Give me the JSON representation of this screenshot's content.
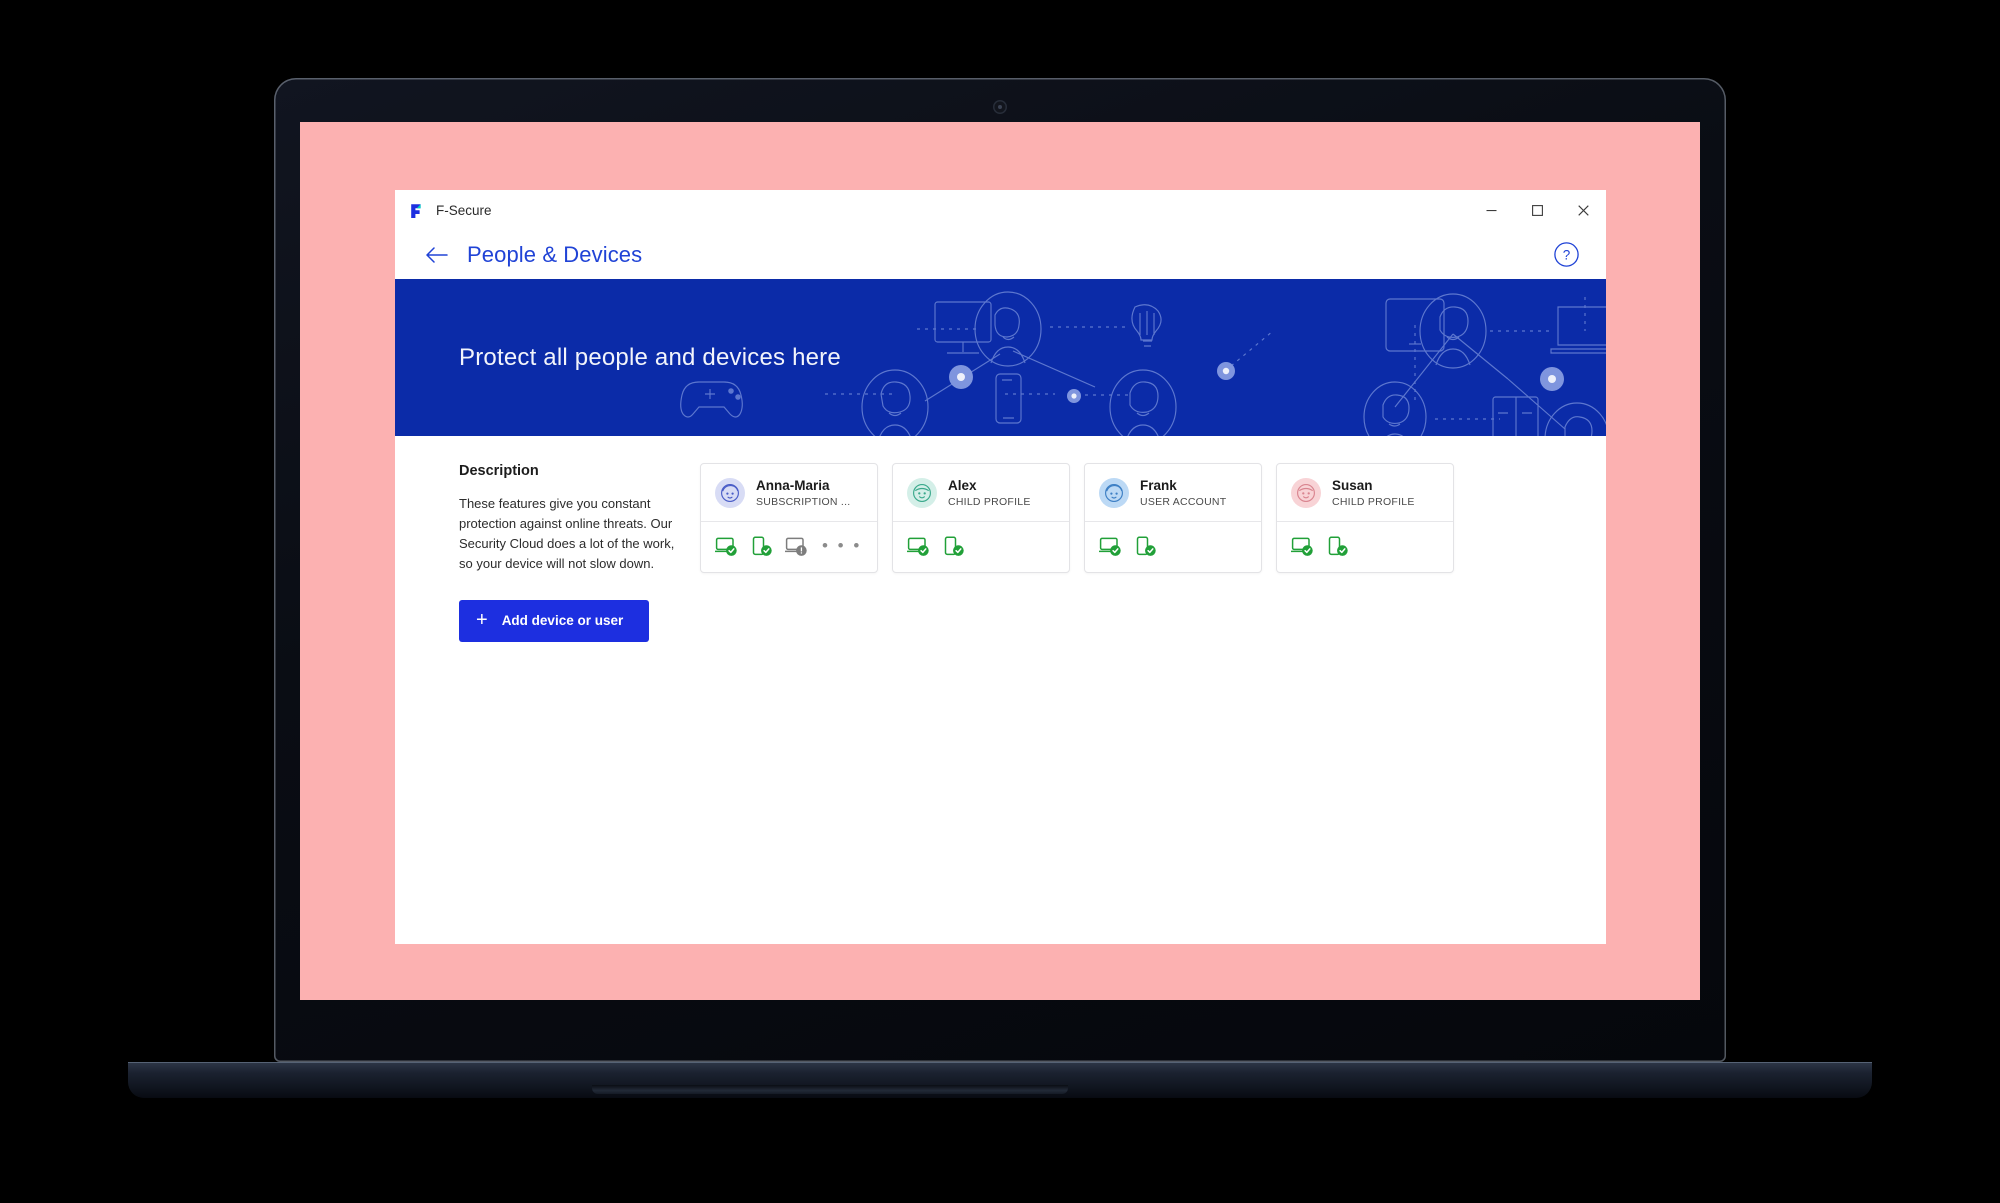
{
  "window": {
    "app_name": "F-Secure",
    "logo_icon": "f-secure-logo-icon",
    "controls": {
      "minimize_label": "─",
      "maximize_label": "□",
      "close_label": "✕",
      "minimize_icon": "minimize-icon",
      "maximize_icon": "maximize-icon",
      "close_icon": "close-icon"
    }
  },
  "header": {
    "back_icon": "arrow-left-icon",
    "title": "People & Devices",
    "help_icon": "help-circle-icon",
    "title_color": "#2043d6"
  },
  "hero": {
    "headline": "Protect all people and devices here",
    "background_color": "#0b2ba8",
    "illustration_name": "connected-devices-network-illustration"
  },
  "description": {
    "heading": "Description",
    "body": "These features give you constant protection against online threats. Our Security Cloud does a lot of the work, so your device will not slow down.",
    "add_button_label": "Add device or user",
    "add_button_icon": "plus-icon",
    "add_button_color": "#1d2fe0"
  },
  "cards": [
    {
      "name": "Anna-Maria",
      "role": "SUBSCRIPTION ...",
      "avatar_icon": "adult-face-icon",
      "avatar_bg": "#d8dcf5",
      "avatar_fg": "#4a5dc7",
      "has_more": true,
      "more_label": "• • •",
      "devices": [
        {
          "type": "laptop",
          "status": "protected",
          "icon": "laptop-protected-icon"
        },
        {
          "type": "phone",
          "status": "protected",
          "icon": "phone-protected-icon"
        },
        {
          "type": "laptop",
          "status": "warning",
          "icon": "laptop-warning-icon"
        }
      ]
    },
    {
      "name": "Alex",
      "role": "CHILD PROFILE",
      "avatar_icon": "child-face-icon",
      "avatar_bg": "#d4efe8",
      "avatar_fg": "#3aa98c",
      "has_more": false,
      "more_label": "",
      "devices": [
        {
          "type": "laptop",
          "status": "protected",
          "icon": "laptop-protected-icon"
        },
        {
          "type": "phone",
          "status": "protected",
          "icon": "phone-protected-icon"
        }
      ]
    },
    {
      "name": "Frank",
      "role": "USER ACCOUNT",
      "avatar_icon": "adult-face-icon",
      "avatar_bg": "#bcd9f5",
      "avatar_fg": "#3d7fc4",
      "has_more": false,
      "more_label": "",
      "devices": [
        {
          "type": "laptop",
          "status": "protected",
          "icon": "laptop-protected-icon"
        },
        {
          "type": "phone",
          "status": "protected",
          "icon": "phone-protected-icon"
        }
      ]
    },
    {
      "name": "Susan",
      "role": "CHILD PROFILE",
      "avatar_icon": "child-face-icon",
      "avatar_bg": "#f8d3d6",
      "avatar_fg": "#d9848f",
      "has_more": false,
      "more_label": "",
      "devices": [
        {
          "type": "laptop",
          "status": "protected",
          "icon": "laptop-protected-icon"
        },
        {
          "type": "phone",
          "status": "protected",
          "icon": "phone-protected-icon"
        }
      ]
    }
  ],
  "desktop": {
    "wallpaper_color": "#fcb1b1"
  },
  "colors": {
    "protected_green": "#21a038",
    "warning_gray": "#7d7d7d",
    "card_border": "#e3e3e6"
  }
}
